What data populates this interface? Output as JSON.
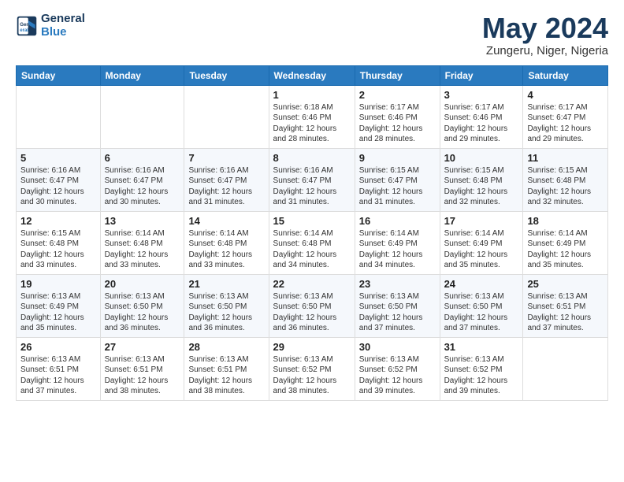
{
  "header": {
    "logo_line1": "General",
    "logo_line2": "Blue",
    "title": "May 2024",
    "subtitle": "Zungeru, Niger, Nigeria"
  },
  "weekdays": [
    "Sunday",
    "Monday",
    "Tuesday",
    "Wednesday",
    "Thursday",
    "Friday",
    "Saturday"
  ],
  "weeks": [
    [
      {
        "day": "",
        "info": ""
      },
      {
        "day": "",
        "info": ""
      },
      {
        "day": "",
        "info": ""
      },
      {
        "day": "1",
        "info": "Sunrise: 6:18 AM\nSunset: 6:46 PM\nDaylight: 12 hours and 28 minutes."
      },
      {
        "day": "2",
        "info": "Sunrise: 6:17 AM\nSunset: 6:46 PM\nDaylight: 12 hours and 28 minutes."
      },
      {
        "day": "3",
        "info": "Sunrise: 6:17 AM\nSunset: 6:46 PM\nDaylight: 12 hours and 29 minutes."
      },
      {
        "day": "4",
        "info": "Sunrise: 6:17 AM\nSunset: 6:47 PM\nDaylight: 12 hours and 29 minutes."
      }
    ],
    [
      {
        "day": "5",
        "info": "Sunrise: 6:16 AM\nSunset: 6:47 PM\nDaylight: 12 hours and 30 minutes."
      },
      {
        "day": "6",
        "info": "Sunrise: 6:16 AM\nSunset: 6:47 PM\nDaylight: 12 hours and 30 minutes."
      },
      {
        "day": "7",
        "info": "Sunrise: 6:16 AM\nSunset: 6:47 PM\nDaylight: 12 hours and 31 minutes."
      },
      {
        "day": "8",
        "info": "Sunrise: 6:16 AM\nSunset: 6:47 PM\nDaylight: 12 hours and 31 minutes."
      },
      {
        "day": "9",
        "info": "Sunrise: 6:15 AM\nSunset: 6:47 PM\nDaylight: 12 hours and 31 minutes."
      },
      {
        "day": "10",
        "info": "Sunrise: 6:15 AM\nSunset: 6:48 PM\nDaylight: 12 hours and 32 minutes."
      },
      {
        "day": "11",
        "info": "Sunrise: 6:15 AM\nSunset: 6:48 PM\nDaylight: 12 hours and 32 minutes."
      }
    ],
    [
      {
        "day": "12",
        "info": "Sunrise: 6:15 AM\nSunset: 6:48 PM\nDaylight: 12 hours and 33 minutes."
      },
      {
        "day": "13",
        "info": "Sunrise: 6:14 AM\nSunset: 6:48 PM\nDaylight: 12 hours and 33 minutes."
      },
      {
        "day": "14",
        "info": "Sunrise: 6:14 AM\nSunset: 6:48 PM\nDaylight: 12 hours and 33 minutes."
      },
      {
        "day": "15",
        "info": "Sunrise: 6:14 AM\nSunset: 6:48 PM\nDaylight: 12 hours and 34 minutes."
      },
      {
        "day": "16",
        "info": "Sunrise: 6:14 AM\nSunset: 6:49 PM\nDaylight: 12 hours and 34 minutes."
      },
      {
        "day": "17",
        "info": "Sunrise: 6:14 AM\nSunset: 6:49 PM\nDaylight: 12 hours and 35 minutes."
      },
      {
        "day": "18",
        "info": "Sunrise: 6:14 AM\nSunset: 6:49 PM\nDaylight: 12 hours and 35 minutes."
      }
    ],
    [
      {
        "day": "19",
        "info": "Sunrise: 6:13 AM\nSunset: 6:49 PM\nDaylight: 12 hours and 35 minutes."
      },
      {
        "day": "20",
        "info": "Sunrise: 6:13 AM\nSunset: 6:50 PM\nDaylight: 12 hours and 36 minutes."
      },
      {
        "day": "21",
        "info": "Sunrise: 6:13 AM\nSunset: 6:50 PM\nDaylight: 12 hours and 36 minutes."
      },
      {
        "day": "22",
        "info": "Sunrise: 6:13 AM\nSunset: 6:50 PM\nDaylight: 12 hours and 36 minutes."
      },
      {
        "day": "23",
        "info": "Sunrise: 6:13 AM\nSunset: 6:50 PM\nDaylight: 12 hours and 37 minutes."
      },
      {
        "day": "24",
        "info": "Sunrise: 6:13 AM\nSunset: 6:50 PM\nDaylight: 12 hours and 37 minutes."
      },
      {
        "day": "25",
        "info": "Sunrise: 6:13 AM\nSunset: 6:51 PM\nDaylight: 12 hours and 37 minutes."
      }
    ],
    [
      {
        "day": "26",
        "info": "Sunrise: 6:13 AM\nSunset: 6:51 PM\nDaylight: 12 hours and 37 minutes."
      },
      {
        "day": "27",
        "info": "Sunrise: 6:13 AM\nSunset: 6:51 PM\nDaylight: 12 hours and 38 minutes."
      },
      {
        "day": "28",
        "info": "Sunrise: 6:13 AM\nSunset: 6:51 PM\nDaylight: 12 hours and 38 minutes."
      },
      {
        "day": "29",
        "info": "Sunrise: 6:13 AM\nSunset: 6:52 PM\nDaylight: 12 hours and 38 minutes."
      },
      {
        "day": "30",
        "info": "Sunrise: 6:13 AM\nSunset: 6:52 PM\nDaylight: 12 hours and 39 minutes."
      },
      {
        "day": "31",
        "info": "Sunrise: 6:13 AM\nSunset: 6:52 PM\nDaylight: 12 hours and 39 minutes."
      },
      {
        "day": "",
        "info": ""
      }
    ]
  ]
}
